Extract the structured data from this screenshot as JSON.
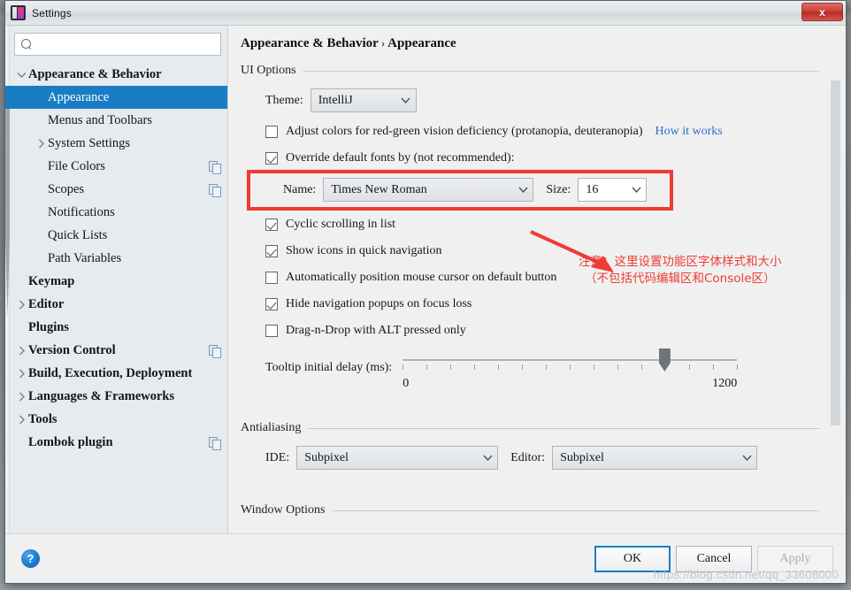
{
  "window": {
    "title": "Settings",
    "app_icon": "intellij-icon",
    "close_label": "x"
  },
  "sidebar": {
    "search": {
      "value": "",
      "placeholder": "",
      "icon": "search-icon"
    },
    "items": [
      {
        "label": "Appearance & Behavior",
        "bold": true,
        "indent": 0,
        "twisty": "down",
        "selected": false,
        "copy": false
      },
      {
        "label": "Appearance",
        "bold": false,
        "indent": 1,
        "twisty": "none",
        "selected": true,
        "copy": false
      },
      {
        "label": "Menus and Toolbars",
        "bold": false,
        "indent": 1,
        "twisty": "none",
        "selected": false,
        "copy": false
      },
      {
        "label": "System Settings",
        "bold": false,
        "indent": 1,
        "twisty": "right",
        "selected": false,
        "copy": false
      },
      {
        "label": "File Colors",
        "bold": false,
        "indent": 1,
        "twisty": "none",
        "selected": false,
        "copy": true
      },
      {
        "label": "Scopes",
        "bold": false,
        "indent": 1,
        "twisty": "none",
        "selected": false,
        "copy": true
      },
      {
        "label": "Notifications",
        "bold": false,
        "indent": 1,
        "twisty": "none",
        "selected": false,
        "copy": false
      },
      {
        "label": "Quick Lists",
        "bold": false,
        "indent": 1,
        "twisty": "none",
        "selected": false,
        "copy": false
      },
      {
        "label": "Path Variables",
        "bold": false,
        "indent": 1,
        "twisty": "none",
        "selected": false,
        "copy": false
      },
      {
        "label": "Keymap",
        "bold": true,
        "indent": 0,
        "twisty": "none",
        "selected": false,
        "copy": false
      },
      {
        "label": "Editor",
        "bold": true,
        "indent": 0,
        "twisty": "right",
        "selected": false,
        "copy": false
      },
      {
        "label": "Plugins",
        "bold": true,
        "indent": 0,
        "twisty": "none",
        "selected": false,
        "copy": false
      },
      {
        "label": "Version Control",
        "bold": true,
        "indent": 0,
        "twisty": "right",
        "selected": false,
        "copy": true
      },
      {
        "label": "Build, Execution, Deployment",
        "bold": true,
        "indent": 0,
        "twisty": "right",
        "selected": false,
        "copy": false
      },
      {
        "label": "Languages & Frameworks",
        "bold": true,
        "indent": 0,
        "twisty": "right",
        "selected": false,
        "copy": false
      },
      {
        "label": "Tools",
        "bold": true,
        "indent": 0,
        "twisty": "right",
        "selected": false,
        "copy": false
      },
      {
        "label": "Lombok plugin",
        "bold": true,
        "indent": 0,
        "twisty": "none",
        "selected": false,
        "copy": true
      }
    ]
  },
  "main": {
    "breadcrumb": {
      "root": "Appearance & Behavior",
      "separator": "›",
      "leaf": "Appearance"
    },
    "ui_options": {
      "group_title": "UI Options",
      "theme": {
        "label": "Theme:",
        "value": "IntelliJ"
      },
      "adjust_colors": {
        "label": "Adjust colors for red-green vision deficiency (protanopia, deuteranopia)",
        "checked": false,
        "link": "How it works"
      },
      "override_fonts": {
        "label": "Override default fonts by (not recommended):",
        "checked": true
      },
      "font_name": {
        "label": "Name:",
        "value": "Times New Roman"
      },
      "font_size": {
        "label": "Size:",
        "value": "16"
      },
      "checkboxes": [
        {
          "label": "Cyclic scrolling in list",
          "checked": true
        },
        {
          "label": "Show icons in quick navigation",
          "checked": true
        },
        {
          "label": "Automatically position mouse cursor on default button",
          "checked": false
        },
        {
          "label": "Hide navigation popups on focus loss",
          "checked": true
        },
        {
          "label": "Drag-n-Drop with ALT pressed only",
          "checked": false
        }
      ],
      "tooltip_delay": {
        "label": "Tooltip initial delay (ms):",
        "min_label": "0",
        "max_label": "1200",
        "min": 0,
        "max": 1200,
        "value": 940,
        "tick_count": 15
      }
    },
    "antialiasing": {
      "group_title": "Antialiasing",
      "ide": {
        "label": "IDE:",
        "value": "Subpixel"
      },
      "editor": {
        "label": "Editor:",
        "value": "Subpixel"
      }
    },
    "window_options": {
      "group_title": "Window Options"
    },
    "annotation": {
      "line1": "注意：这里设置功能区字体样式和大小",
      "line2": "（不包括代码编辑区和Console区）",
      "color": "#f03b33"
    }
  },
  "footer": {
    "help": "?",
    "ok": "OK",
    "cancel": "Cancel",
    "apply": "Apply",
    "watermark": "https://blog.csdn.net/qq_33608000"
  },
  "colors": {
    "accent": "#1a7cc4",
    "annotation_red": "#f03b33",
    "link_blue": "#2f6fc0",
    "sidebar_bg": "#e6ebef"
  }
}
